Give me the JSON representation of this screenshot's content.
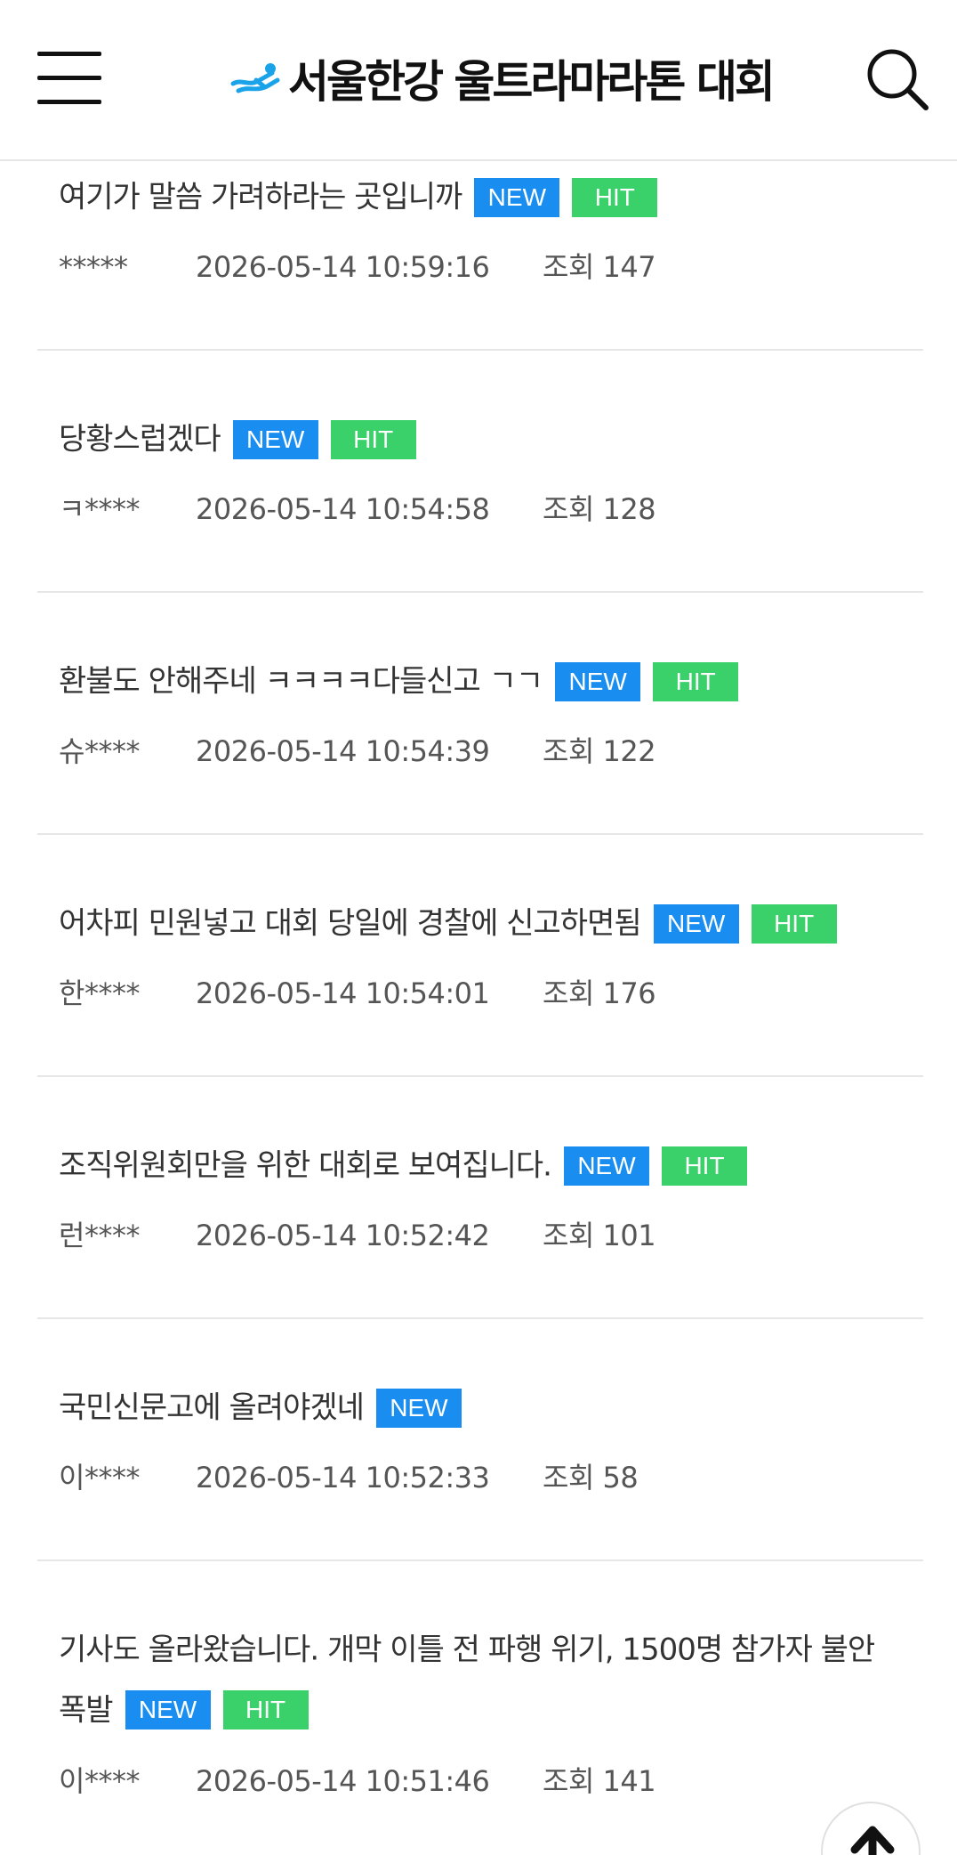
{
  "header": {
    "site_title": "서울한강 울트라마라톤 대회"
  },
  "colors": {
    "new_badge": "#1a8ef0",
    "hit_badge": "#3ad16a",
    "logo_mark": "#1aa3e8"
  },
  "icons": {
    "menu": "hamburger-icon",
    "search": "search-icon",
    "top": "arrow-up-icon",
    "logo": "runner-logo-icon"
  },
  "posts": [
    {
      "title": "여기가 말씀 가려하라는 곳입니까",
      "new": "NEW",
      "hit": "HIT",
      "author": "*****",
      "date": "2026-05-14 10:59:16",
      "views": "조회 147"
    },
    {
      "title": "당황스럽겠다",
      "new": "NEW",
      "hit": "HIT",
      "author": "ㅋ****",
      "date": "2026-05-14 10:54:58",
      "views": "조회 128"
    },
    {
      "title": "환불도 안해주네 ㅋㅋㅋㅋ다들신고 ㄱㄱ",
      "new": "NEW",
      "hit": "HIT",
      "author": "슈****",
      "date": "2026-05-14 10:54:39",
      "views": "조회 122"
    },
    {
      "title": "어차피 민원넣고 대회 당일에 경찰에 신고하면됨",
      "new": "NEW",
      "hit": "HIT",
      "author": "한****",
      "date": "2026-05-14 10:54:01",
      "views": "조회 176"
    },
    {
      "title": "조직위원회만을 위한 대회로 보여집니다.",
      "new": "NEW",
      "hit": "HIT",
      "author": "런****",
      "date": "2026-05-14 10:52:42",
      "views": "조회 101"
    },
    {
      "title": "국민신문고에 올려야겠네",
      "new": "NEW",
      "hit": null,
      "author": "이****",
      "date": "2026-05-14 10:52:33",
      "views": "조회 58"
    },
    {
      "title": "기사도 올라왔습니다. 개막 이틀 전 파행 위기, 1500명 참가자 불안 폭발",
      "new": "NEW",
      "hit": "HIT",
      "author": "이****",
      "date": "2026-05-14 10:51:46",
      "views": "조회 141"
    }
  ]
}
